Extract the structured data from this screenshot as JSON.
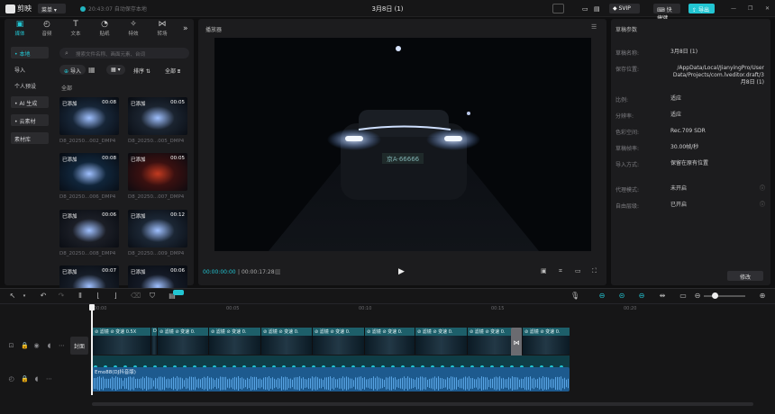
{
  "app": {
    "name": "剪映",
    "menu": "菜单",
    "autosave": "20:43:07 自动保存本地",
    "window_title": "3月8日 (1)",
    "svip": "SVIP",
    "shortcut": "快捷键",
    "export": "导出"
  },
  "tabs": [
    {
      "label": "媒体",
      "icon": "media-icon"
    },
    {
      "label": "音频",
      "icon": "audio-icon"
    },
    {
      "label": "文本",
      "icon": "text-icon"
    },
    {
      "label": "贴纸",
      "icon": "sticker-icon"
    },
    {
      "label": "特效",
      "icon": "effects-icon"
    },
    {
      "label": "转场",
      "icon": "transition-icon"
    }
  ],
  "sidebar": [
    "• 本地",
    "导入",
    "个人预设",
    "• AI 生成",
    "• 云素材",
    "素材库"
  ],
  "media": {
    "search_placeholder": "搜索文件名称、画面元素、台词",
    "import": "导入",
    "sort": "排序",
    "all_filter": "全部",
    "section": "全部",
    "clips": [
      {
        "added": "已添加",
        "dur": "00:08",
        "name": "D8_20250...002_DMP4"
      },
      {
        "added": "已添加",
        "dur": "00:05",
        "name": "D8_20250...005_DMP4"
      },
      {
        "added": "已添加",
        "dur": "00:08",
        "name": "D8_20250...006_DMP4"
      },
      {
        "added": "已添加",
        "dur": "00:05",
        "name": "D8_20250...007_DMP4"
      },
      {
        "added": "已添加",
        "dur": "00:06",
        "name": "D8_20250...008_DMP4"
      },
      {
        "added": "已添加",
        "dur": "00:12",
        "name": "D8_20250...009_DMP4"
      },
      {
        "added": "已添加",
        "dur": "00:07",
        "name": ""
      },
      {
        "added": "已添加",
        "dur": "00:06",
        "name": ""
      }
    ]
  },
  "player": {
    "title": "播放器",
    "current": "00:00:00:00",
    "total": "00:00:17:28",
    "plate": "京A·66666"
  },
  "props": {
    "title": "草稿参数",
    "rows": [
      {
        "label": "草稿名称:",
        "value": "3月8日 (1)"
      },
      {
        "label": "保存位置:",
        "value": "/AppData/Local/JianyingPro/User Data/Projects/com.lveditor.draft/3月8日 (1)"
      },
      {
        "label": "比例:",
        "value": "适应"
      },
      {
        "label": "分辨率:",
        "value": "适应"
      },
      {
        "label": "色彩空间:",
        "value": "Rec.709 SDR"
      },
      {
        "label": "草稿帧率:",
        "value": "30.00帧/秒"
      },
      {
        "label": "导入方式:",
        "value": "保留在原有位置"
      },
      {
        "label": "代理模式:",
        "value": "未开启"
      },
      {
        "label": "自由层级:",
        "value": "已开启"
      }
    ],
    "modify": "修改"
  },
  "timeline": {
    "ticks": [
      "00:00",
      "00:05",
      "00:10",
      "00:15",
      "00:20"
    ],
    "cover": "封面",
    "audio_name": "Emo88(DJ抖音版)",
    "segments": [
      "⊘ 滤镜 ⊘ 变速 0.5X",
      "D",
      "⊘ 滤镜 ⊘ 变速 0.",
      "⊘ 滤镜 ⊘ 变速 0.",
      "⊘ 滤镜 ⊘ 变速 0.",
      "⊘ 滤镜 ⊘ 变速 0.",
      "⊘ 滤镜 ⊘ 变速 0.",
      "⊘ 滤镜 ⊘ 变速 0.",
      "⊘ 滤镜 ⊘ 变速 0.",
      "⊘ 滤镜 ⊘ 变速 0.",
      "⊘ 滤镜 ⊘ 变速 0."
    ]
  },
  "colors": {
    "accent": "#22c5d2",
    "bg": "#0f0f10",
    "panel": "#1c1c1e",
    "clip": "#1d5f6a",
    "audio": "#1e5f96"
  }
}
